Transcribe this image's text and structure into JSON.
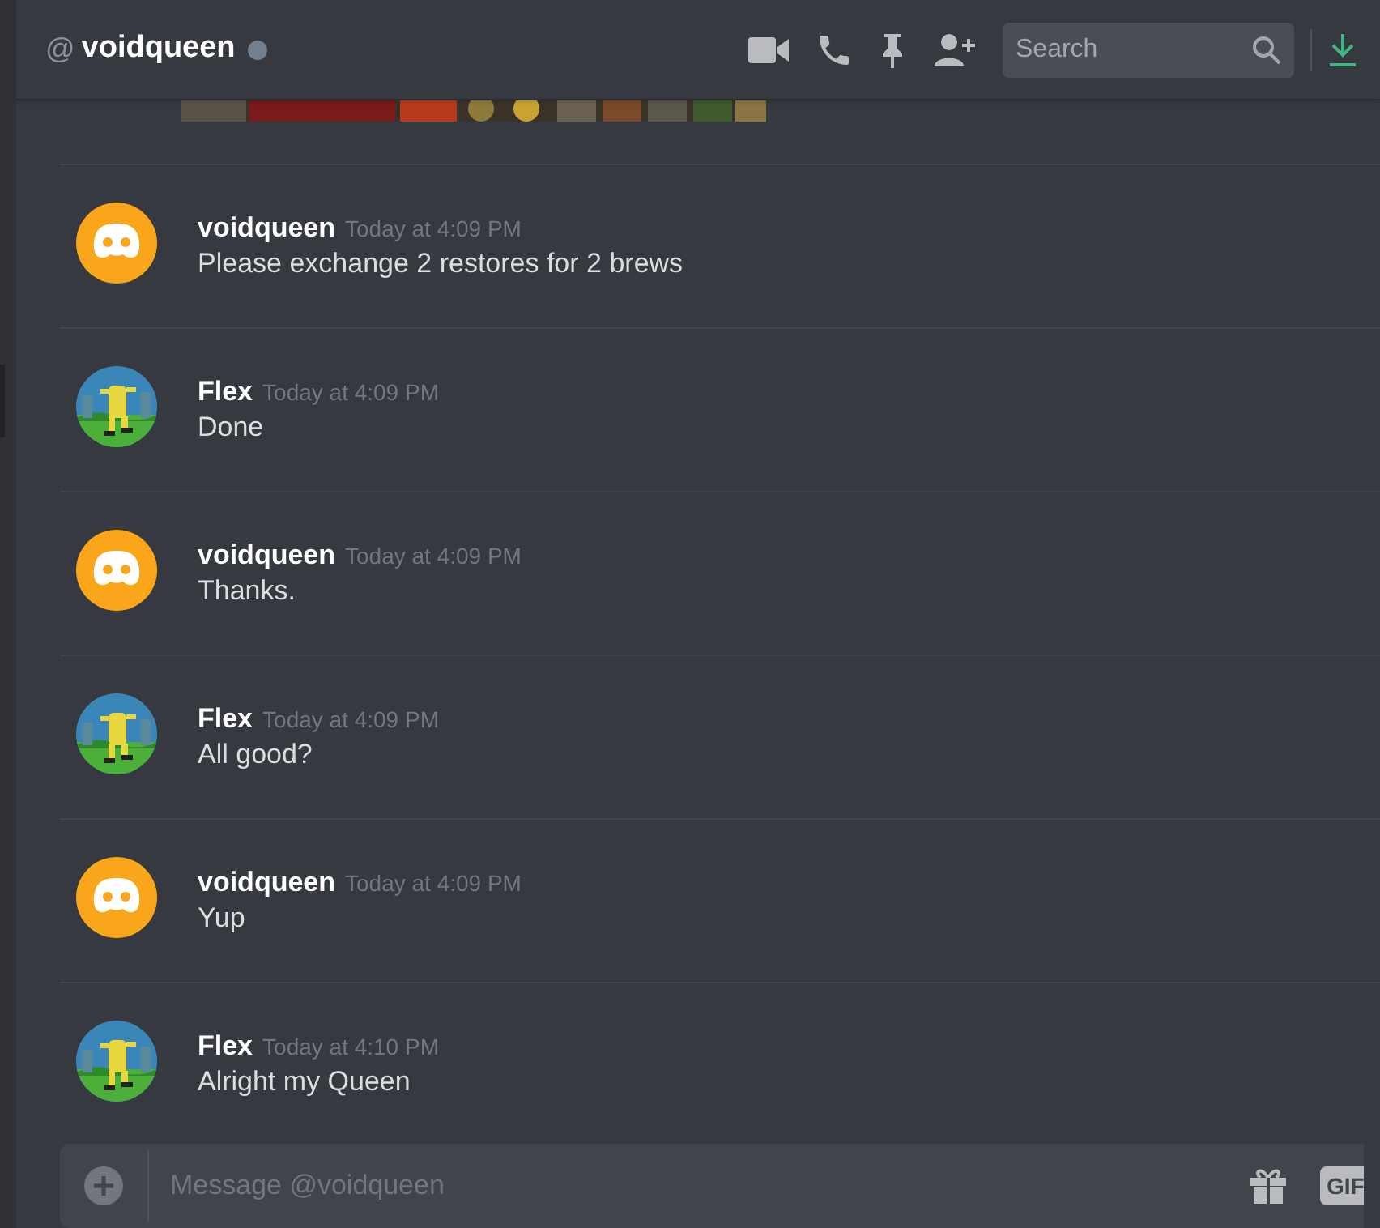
{
  "header": {
    "prefix": "@",
    "title": "voidqueen",
    "online": false,
    "search": {
      "placeholder": "Search"
    }
  },
  "messages": [
    {
      "author": "voidqueen",
      "kind": "logo",
      "time": "Today at 4:09 PM",
      "text": "Please exchange 2 restores for 2 brews"
    },
    {
      "author": "Flex",
      "kind": "picture",
      "time": "Today at 4:09 PM",
      "text": "Done"
    },
    {
      "author": "voidqueen",
      "kind": "logo",
      "time": "Today at 4:09 PM",
      "text": "Thanks."
    },
    {
      "author": "Flex",
      "kind": "picture",
      "time": "Today at 4:09 PM",
      "text": "All good?"
    },
    {
      "author": "voidqueen",
      "kind": "logo",
      "time": "Today at 4:09 PM",
      "text": "Yup"
    },
    {
      "author": "Flex",
      "kind": "picture",
      "time": "Today at 4:10 PM",
      "text": "Alright my Queen"
    }
  ],
  "composer": {
    "placeholder": "Message @voidqueen",
    "gif": "GIF"
  }
}
